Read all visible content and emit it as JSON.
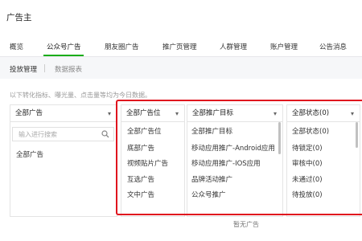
{
  "page_title": "广告主",
  "tabs": [
    {
      "label": "概览",
      "active": false
    },
    {
      "label": "公众号广告",
      "active": true
    },
    {
      "label": "朋友圈广告",
      "active": false
    },
    {
      "label": "推广页管理",
      "active": false
    },
    {
      "label": "人群管理",
      "active": false
    },
    {
      "label": "账户管理",
      "active": false
    },
    {
      "label": "公告消息",
      "active": false
    }
  ],
  "subtabs": [
    {
      "label": "投放管理",
      "active": true
    },
    {
      "label": "数据报表",
      "active": false
    }
  ],
  "hint": "以下转化指标、曝光量、点击量等均为今日数据。",
  "filters": {
    "all_ads": {
      "label": "全部广告",
      "search_placeholder": "输入进行搜索",
      "options": [
        "全部广告"
      ]
    },
    "position": {
      "label": "全部广告位",
      "options": [
        "全部广告位",
        "底部广告",
        "视频贴片广告",
        "互选广告",
        "文中广告"
      ]
    },
    "target": {
      "label": "全部推广目标",
      "options": [
        "全部推广目标",
        "移动应用推广-Android应用",
        "移动应用推广-IOS应用",
        "品牌活动推广",
        "公众号推广"
      ]
    },
    "status": {
      "label": "全部状态(0)",
      "options": [
        "全部状态(0)",
        "待锁定(0)",
        "审核中(0)",
        "未通过(0)",
        "待投放(0)"
      ]
    }
  },
  "empty_text": "暂无广告",
  "colors": {
    "accent": "#1aad19",
    "highlight": "#e0141e"
  },
  "icons": {
    "search": "search-icon",
    "dropdown": "chevron-down-icon"
  }
}
